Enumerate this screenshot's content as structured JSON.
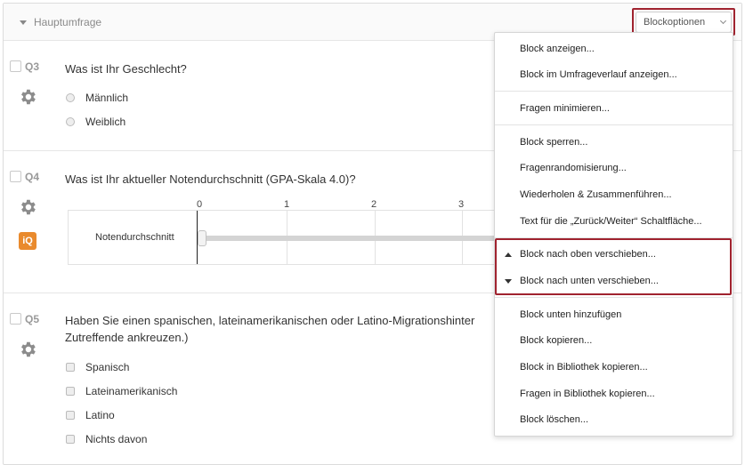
{
  "block": {
    "title": "Hauptumfrage",
    "options_label": "Blockoptionen"
  },
  "questions": [
    {
      "number": "Q3",
      "text": "Was ist Ihr Geschlecht?",
      "options": [
        "Männlich",
        "Weiblich"
      ]
    },
    {
      "number": "Q4",
      "text": "Was ist Ihr aktueller Notendurchschnitt (GPA-Skala 4.0)?",
      "scale_ticks": [
        "0",
        "1",
        "2",
        "3"
      ],
      "slider_label": "Notendurchschnitt",
      "badge": "iQ"
    },
    {
      "number": "Q5",
      "text_line1": "Haben Sie einen spanischen, lateinamerikanischen oder Latino-Migrationshinter",
      "text_line2": "Zutreffende ankreuzen.)",
      "options": [
        "Spanisch",
        "Lateinamerikanisch",
        "Latino",
        "Nichts davon"
      ]
    }
  ],
  "menu": {
    "items": [
      "Block anzeigen...",
      "Block im Umfrageverlauf anzeigen...",
      "Fragen minimieren...",
      "Block sperren...",
      "Fragenrandomisierung...",
      "Wiederholen & Zusammenführen...",
      "Text für die „Zurück/Weiter“ Schaltfläche...",
      "Block nach oben verschieben...",
      "Block nach unten verschieben...",
      "Block unten hinzufügen",
      "Block kopieren...",
      "Block in Bibliothek kopieren...",
      "Fragen in Bibliothek kopieren...",
      "Block löschen..."
    ]
  },
  "colors": {
    "highlight": "#a0232f",
    "badge": "#e98a2d"
  }
}
